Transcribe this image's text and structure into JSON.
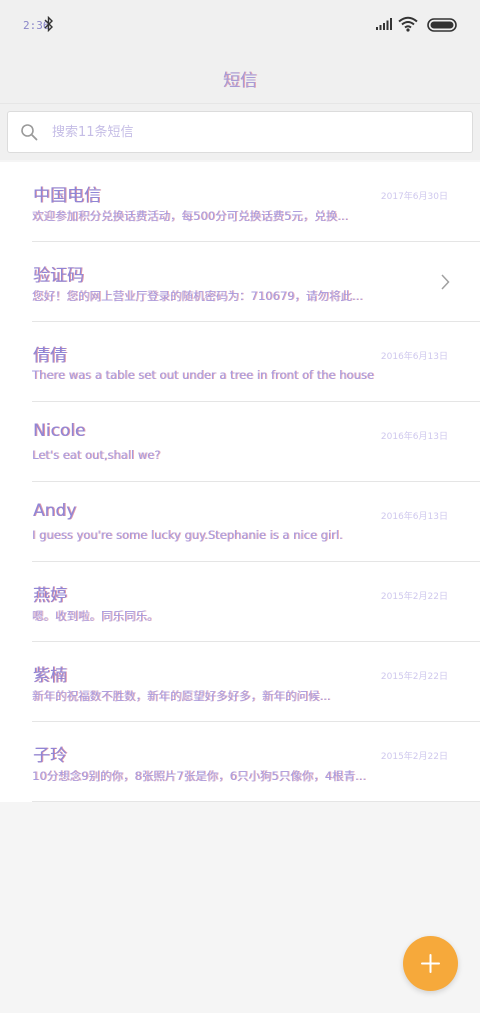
{
  "status_bar": {
    "time": "2:36",
    "icons": [
      "bluetooth-icon",
      "signal-icon",
      "wifi-icon",
      "battery-icon"
    ]
  },
  "header": {
    "title": "短信"
  },
  "search": {
    "placeholder": "搜索11条短信",
    "value": ""
  },
  "messages": [
    {
      "name": "中国电信",
      "preview": "欢迎参加积分兑换话费活动，每500分可兑换话费5元，兑换...",
      "date": "2017年6月30日",
      "has_chevron": false
    },
    {
      "name": "验证码",
      "preview": "您好！您的网上营业厅登录的随机密码为：710679，请勿将此...",
      "date": "",
      "has_chevron": true
    },
    {
      "name": "倩倩",
      "preview": "There was a table set out under a tree in front of the house",
      "date": "2016年6月13日",
      "has_chevron": false
    },
    {
      "name": "Nicole",
      "preview": "Let's eat out,shall we?",
      "date": "2016年6月13日",
      "has_chevron": false
    },
    {
      "name": "Andy",
      "preview": "I guess you're some lucky guy.Stephanie is a nice girl.",
      "date": "2016年6月13日",
      "has_chevron": false
    },
    {
      "name": "燕婷",
      "preview": "嗯。收到啦。同乐同乐。",
      "date": "2015年2月22日",
      "has_chevron": false
    },
    {
      "name": "紫楠",
      "preview": "新年的祝福数不胜数，新年的愿望好多好多，新年的问候...",
      "date": "2015年2月22日",
      "has_chevron": false
    },
    {
      "name": "子玲",
      "preview": "10分想念9别的你，8张照片7张是你，6只小狗5只像你，4根青...",
      "date": "2015年2月22日",
      "has_chevron": false
    }
  ],
  "fab": {
    "icon": "plus-icon",
    "color": "#f6a93b"
  },
  "colors": {
    "accent": "#f6a93b",
    "name_text": "#8f86d6",
    "preview_text": "#a79bdf"
  }
}
